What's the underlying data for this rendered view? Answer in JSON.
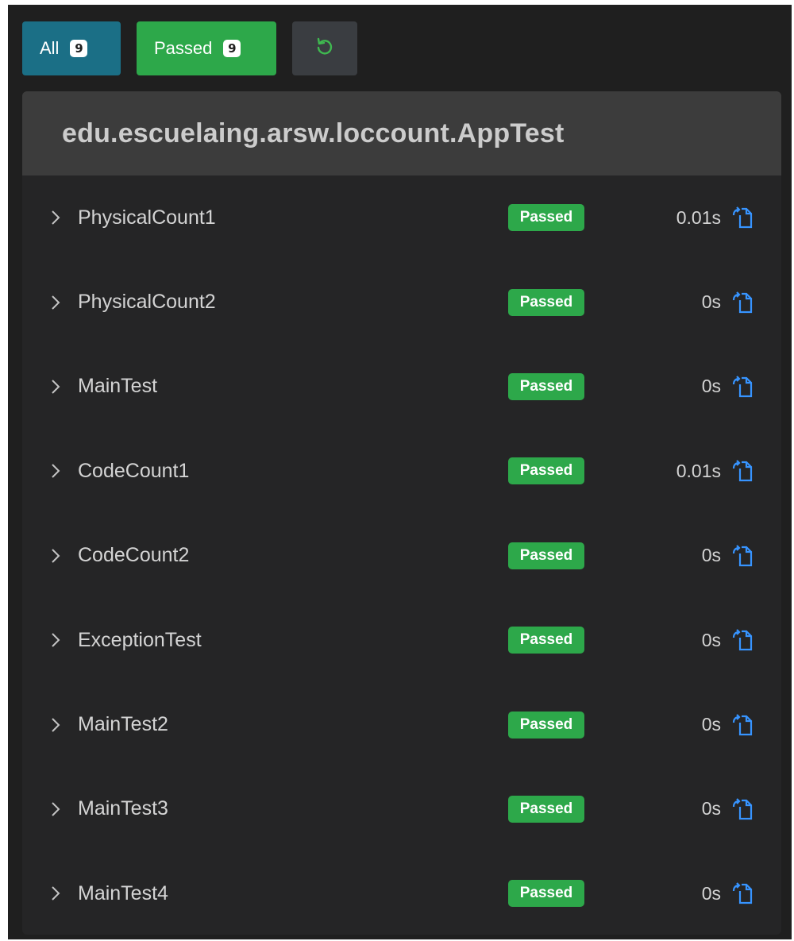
{
  "toolbar": {
    "all_label": "All",
    "all_count": "9",
    "passed_label": "Passed",
    "passed_count": "9",
    "reset_icon": "refresh-icon"
  },
  "panel": {
    "title": "edu.escuelaing.arsw.loccount.AppTest"
  },
  "tests": [
    {
      "name": "PhysicalCount1",
      "status": "Passed",
      "duration": "0.01s"
    },
    {
      "name": "PhysicalCount2",
      "status": "Passed",
      "duration": "0s"
    },
    {
      "name": "MainTest",
      "status": "Passed",
      "duration": "0s"
    },
    {
      "name": "CodeCount1",
      "status": "Passed",
      "duration": "0.01s"
    },
    {
      "name": "CodeCount2",
      "status": "Passed",
      "duration": "0s"
    },
    {
      "name": "ExceptionTest",
      "status": "Passed",
      "duration": "0s"
    },
    {
      "name": "MainTest2",
      "status": "Passed",
      "duration": "0s"
    },
    {
      "name": "MainTest3",
      "status": "Passed",
      "duration": "0s"
    },
    {
      "name": "MainTest4",
      "status": "Passed",
      "duration": "0s"
    }
  ],
  "colors": {
    "background": "#1f1f1f",
    "panel": "#252526",
    "header": "#3c3c3c",
    "all_button": "#1b6f86",
    "passed": "#2da84a",
    "icon_blue": "#3794ff"
  }
}
